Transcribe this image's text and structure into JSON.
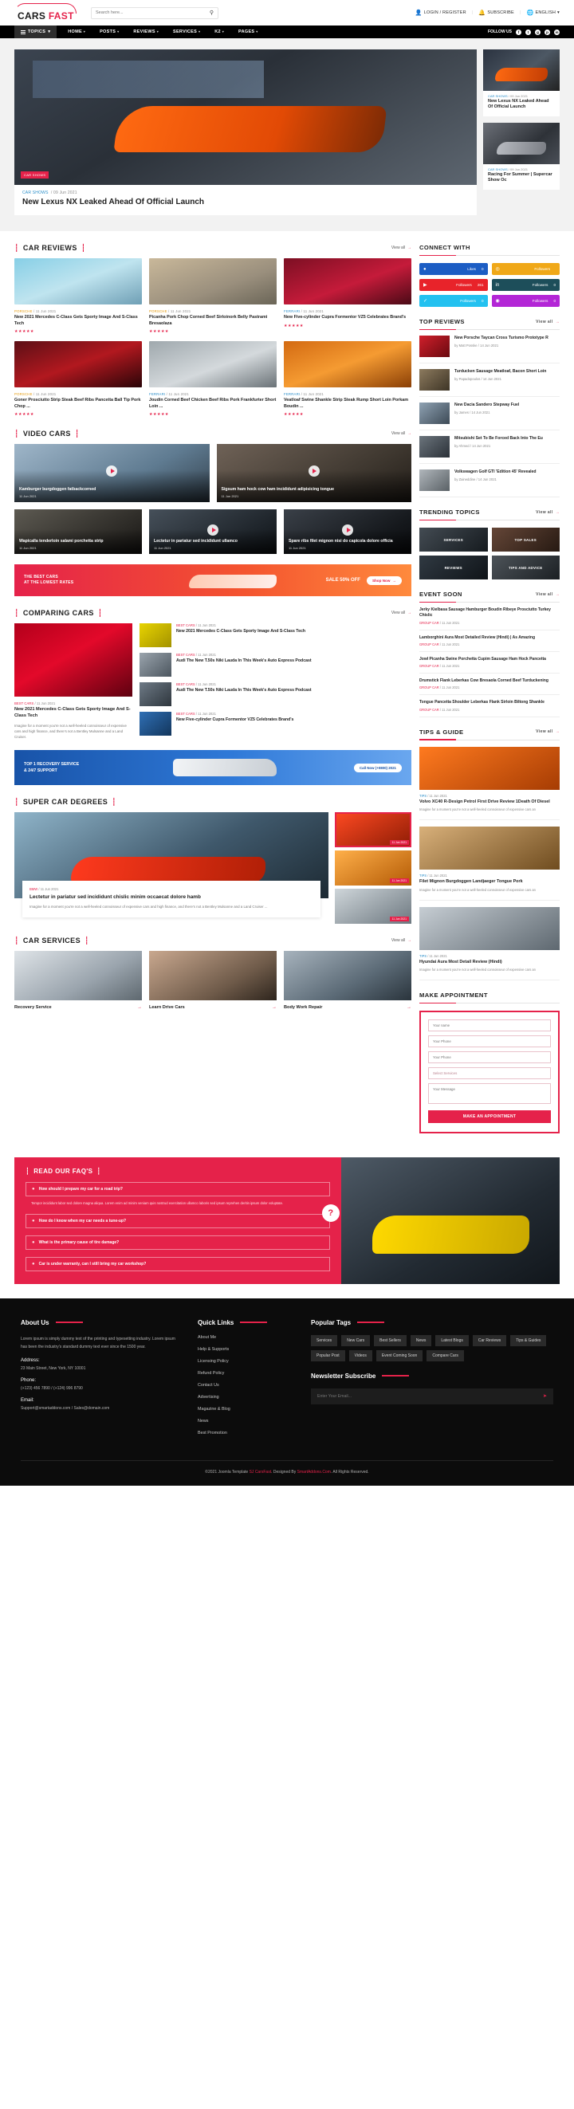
{
  "header": {
    "logo_main": "CARS",
    "logo_accent": "FAST",
    "search_placeholder": "Search here...",
    "search_value": "",
    "search_icon": "search-icon",
    "links": [
      {
        "icon": "user-icon",
        "label": "LOGIN / REGISTER"
      },
      {
        "icon": "bell-icon",
        "label": "SUBSCRIBE"
      },
      {
        "icon": "globe-icon",
        "label": "ENGLISH"
      }
    ]
  },
  "nav": {
    "topics_label": "TOPICS",
    "items": [
      "HOME",
      "POSTS",
      "REVIEWS",
      "SERVICES",
      "K2",
      "PAGES"
    ],
    "follow_label": "FOLLOW US",
    "socials": [
      "f",
      "t",
      "g",
      "p",
      "in"
    ]
  },
  "hero": {
    "main": {
      "badge": "CAR SHOWS",
      "category": "CAR SHOWS",
      "date": "09 Jun 2021",
      "title": "New Lexus NX Leaked Ahead Of Official Launch"
    },
    "side": [
      {
        "category": "CAR SHOWS",
        "date": "09 Jun 2021",
        "title": "New Lexus NX Leaked Ahead Of Official Launch"
      },
      {
        "category": "CAR SHOWS",
        "date": "09 Jun 2021",
        "title": "Racing For Summer | Supercar Show Oc"
      }
    ]
  },
  "view_all": "View all",
  "car_reviews": {
    "title": "CAR REVIEWS",
    "items": [
      {
        "category": "PORSCHE",
        "date": "11 Jun 2021",
        "title": "New 2021 Mercedes C-Class Gets Sporty Image And S-Class Tech",
        "stars": "★★★★★"
      },
      {
        "category": "PORSCHE",
        "date": "11 Jun 2021",
        "title": "Picanha Pork Chop Corned Beef Sirloinork Belly Pastrami Bresaolaza",
        "stars": "★★★★★"
      },
      {
        "category": "FERRARI",
        "date": "11 Jun 2021",
        "title": "New Five-cylinder Cupra Formentor VZ5 Celebrates Brand's",
        "stars": "★★★★★"
      },
      {
        "category": "PORSCHE",
        "date": "11 Jun 2021",
        "title": "Goner Prosciutto Strip Steak Beef Ribs Pancetta Ball Tip Pork Chop ...",
        "stars": "★★★★★"
      },
      {
        "category": "FERRARI",
        "date": "11 Jun 2021",
        "title": "Joudin Corned Beef Chicken Beef Ribs Pork Frankfurter Short Loin ...",
        "stars": "★★★★★"
      },
      {
        "category": "FERRARI",
        "date": "11 Jun 2021",
        "title": "Veatloaf Swine Shankle Strip Steak Rump Short Loin Porkam Boudin ...",
        "stars": "★★★★★"
      }
    ]
  },
  "video_cars": {
    "title": "VIDEO CARS",
    "items": [
      {
        "title": "Kamburger burgdoggen fatbackcorned",
        "date": "11 Jun 2021"
      },
      {
        "title": "Sigsum ham hock cow ham incididunt adipisicing tongue",
        "date": "11 Jun 2021"
      },
      {
        "title": "Wapicalla tenderloin salami porchetta strip",
        "date": "11 Jun 2021"
      },
      {
        "title": "Lectetur in pariatur sed incididunt ullamco",
        "date": "11 Jun 2021"
      },
      {
        "title": "Spare ribs filet mignon nisi do capicola dolore officia",
        "date": "11 Jun 2021"
      }
    ]
  },
  "promo": {
    "line1": "THE BEST CARS",
    "line2": "AT THE LOWEST RATES",
    "off": "SALE 50% OFF",
    "button": "Shop Now"
  },
  "comparing": {
    "title": "COMPARING CARS",
    "featured": {
      "category": "BEST CARS",
      "date": "11 Jun 2021",
      "title": "New 2021 Mercedes C-Class Gets Sporty Image And S-Class Tech",
      "excerpt": "Imagine for a moment you're not a well-heeled connoisseur of expensive cars and high finance, and there's not a Bentley Mulsanne and a Land Cruiser."
    },
    "list": [
      {
        "category": "BEST CARS",
        "date": "11 Jun 2021",
        "title": "New 2021 Mercedes C-Class Gets Sporty Image And S-Class Tech"
      },
      {
        "category": "BEST CARS",
        "date": "11 Jun 2021",
        "title": "Audi The New T.50s Niki Lauda In This Week's Auto Express Podcast"
      },
      {
        "category": "BEST CARS",
        "date": "11 Jun 2021",
        "title": "Audi The New T.50s Niki Lauda In This Week's Auto Express Podcast"
      },
      {
        "category": "BEST CARS",
        "date": "11 Jun 2021",
        "title": "New Five-cylinder Cupra Formentor VZ5 Celebrates Brand's"
      }
    ]
  },
  "support": {
    "line1": "TOP 1 RECOVERY SERVICE",
    "line2": "& 24/7 SUPPORT",
    "button": "Call Now (+0800) 2021"
  },
  "super_car": {
    "title": "SUPER CAR DEGREES",
    "featured": {
      "category": "BMW",
      "date": "11 Jun 2021",
      "title": "Lectetur in pariatur sed incididunt chislic minim occaecat dolore hamb",
      "excerpt": "Imagine for a moment you're not a well-heeled connoisseur of expensive cars and high finance, and there's not a Bentley Mulsanne and a Land Cruiser ..."
    },
    "thumbs": [
      {
        "label": "11 Jun 2021"
      },
      {
        "label": "11 Jun 2021"
      },
      {
        "label": "11 Jun 2021"
      }
    ]
  },
  "car_services": {
    "title": "CAR SERVICES",
    "items": [
      {
        "name": "Recovery Service",
        "arrow": "arrow-right-icon"
      },
      {
        "name": "Learn Drive Cars",
        "arrow": "arrow-right-icon"
      },
      {
        "name": "Body Work Repair",
        "arrow": "arrow-right-icon"
      }
    ]
  },
  "faq": {
    "title": "READ OUR FAQ'S",
    "open_question": "How should I prepare my car for a road trip?",
    "open_answer": "Tempor incididunt labor sed dolore magna aliqua. Lorem enim ad minim veniam quis nostrud exercitation ullamco laboris sed ipsum reprehen deritin ipsum dolor voluptate.",
    "questions": [
      "How do I know when my car needs a tune-up?",
      "What is the primary cause of tire damage?",
      "Car is under warranty, can I still bring my car workshop?"
    ],
    "mark": "?"
  },
  "sidebar": {
    "connect": {
      "title": "CONNECT WITH",
      "items": [
        {
          "network": "facebook-icon",
          "glyph": "f",
          "label": "Likes",
          "count": "0",
          "color": "#1c5dc4"
        },
        {
          "network": "rss-icon",
          "glyph": "◔",
          "label": "Followers",
          "count": "",
          "color": "#f0a818"
        },
        {
          "network": "youtube-icon",
          "glyph": "▶",
          "label": "Followers",
          "count": "261",
          "color": "#e8232a"
        },
        {
          "network": "linkedin-icon",
          "glyph": "in",
          "label": "Followers",
          "count": "0",
          "color": "#1d4e5a"
        },
        {
          "network": "twitter-icon",
          "glyph": "✓",
          "label": "Followers",
          "count": "0",
          "color": "#23c1f0"
        },
        {
          "network": "instagram-icon",
          "glyph": "◎",
          "label": "Followers",
          "count": "0",
          "color": "#b326d6"
        }
      ]
    },
    "top_reviews": {
      "title": "TOP REVIEWS",
      "items": [
        {
          "title": "New Porsche Taycan Cross Turismo Prototype R",
          "by": "by Matt Posske / 14 Jun 2021"
        },
        {
          "title": "Turducken Sausage Meatloaf, Bacon Short Loin",
          "by": "by Papadopoulos / 14 Jun 2021"
        },
        {
          "title": "New Dacia Sandero Stepway Fuel",
          "by": "by James / 14 Jun 2021"
        },
        {
          "title": "Mitsubishi Set To Be Forced Back Into The Eu",
          "by": "by Ahmed / 14 Jun 2021"
        },
        {
          "title": "Volkswagen Golf GTI 'Edition 45' Revealed",
          "by": "by Zaineddine / 14 Jun 2021"
        }
      ]
    },
    "trending": {
      "title": "TRENDING TOPICS",
      "tiles": [
        "SERVICES",
        "TOP SALES",
        "REVIEWS",
        "TIPS AND ADVICE"
      ]
    },
    "events": {
      "title": "EVENT SOON",
      "items": [
        {
          "title": "Jerky Kielbasa Sausage Hamburger Boudin Ribeye Prosciutto Turkey Chislic",
          "category": "GROUP CAR",
          "date": "11 Jun 2021"
        },
        {
          "title": "Lamborghini Aura Most Detailed Review (Hindi) | As Amazing",
          "category": "GROUP CAR",
          "date": "11 Jun 2021"
        },
        {
          "title": "Jowl Picanha Swine Porchetta Cupim Sausage Ham Hock Pancetta",
          "category": "GROUP CAR",
          "date": "11 Jun 2021"
        },
        {
          "title": "Drumstick Flank Leberkas Cow Bresaola Corned Beef Turduckening",
          "category": "GROUP CAR",
          "date": "11 Jun 2021"
        },
        {
          "title": "Tongue Pancetta Shoulder Leberkas Flank Sirloin Biltong Shankle",
          "category": "GROUP CAR",
          "date": "11 Jun 2021"
        }
      ]
    },
    "tips": {
      "title": "TIPS & GUIDE",
      "items": [
        {
          "category": "TIPS",
          "date": "11 Jun 2021",
          "title": "Volvo XC40 R-Design Petrol First Drive Review 1Death Of Diesel",
          "excerpt": "Imagine for a moment you're not a well-heeled connoisseur of expensive cars an"
        },
        {
          "category": "TIPS",
          "date": "11 Jun 2021",
          "title": "Filet Mignon Burgdoggen Landjaeger Tongue Pork",
          "excerpt": "Imagine for a moment you're not a well-heeled connoisseur of expensive cars an"
        },
        {
          "category": "TIPS",
          "date": "11 Jun 2021",
          "title": "Hyundai Aura Most Detail Review (Hindi)",
          "excerpt": "Imagine for a moment you're not a well-heeled connoisseur of expensive cars an"
        }
      ]
    },
    "appointment": {
      "title": "MAKE APPOINTMENT",
      "fields": [
        {
          "name": "name-field",
          "placeholder": "Your name"
        },
        {
          "name": "phone-field",
          "placeholder": "Your Phone"
        },
        {
          "name": "email-field",
          "placeholder": "Your Phone"
        }
      ],
      "select_placeholder": "Select Services",
      "message_placeholder": "Your Message",
      "button": "MAKE AN APPOINTMENT"
    }
  },
  "footer": {
    "about": {
      "title": "About Us",
      "text": "Lorem ipsum is simply dummy text of the printing and typesetting industry. Lorem ipsum has been the industry's standard dummy text ever since the 1500 year.",
      "address_label": "Address:",
      "address_value": "23 Main Street, New York, NY 10001",
      "phone_label": "Phone:",
      "phone_value": "(+123) 456 7890 / (+124) 996 8790",
      "email_label": "Email:",
      "email_value": "Support@smartaddons.com / Sales@domain.com"
    },
    "quick_links": {
      "title": "Quick Links",
      "items": [
        "About Me",
        "Help & Supports",
        "Licensing Policy",
        "Refund Policy",
        "Contact Us",
        "Advertising",
        "Magazine & Blog",
        "News",
        "Best Promotion"
      ]
    },
    "tags": {
      "title": "Popular Tags",
      "items": [
        "Services",
        "New Cars",
        "Best Sellers",
        "News",
        "Latest Blogs",
        "Car Reviews",
        "Tips & Guides",
        "Popular Post",
        "Videos",
        "Event Coming Soon",
        "Compare Cars"
      ]
    },
    "newsletter": {
      "title": "Newsletter Subscribe",
      "placeholder": "Enter Your Email...",
      "value": "",
      "send_icon": "send-icon"
    },
    "copyright_pre": "©2021 Joomla Template ",
    "copyright_link1": "SJ CarsFast",
    "copyright_mid": ". Designed By ",
    "copyright_link2": "SmartAddons.Com",
    "copyright_post": ". All Rights Reserved."
  }
}
